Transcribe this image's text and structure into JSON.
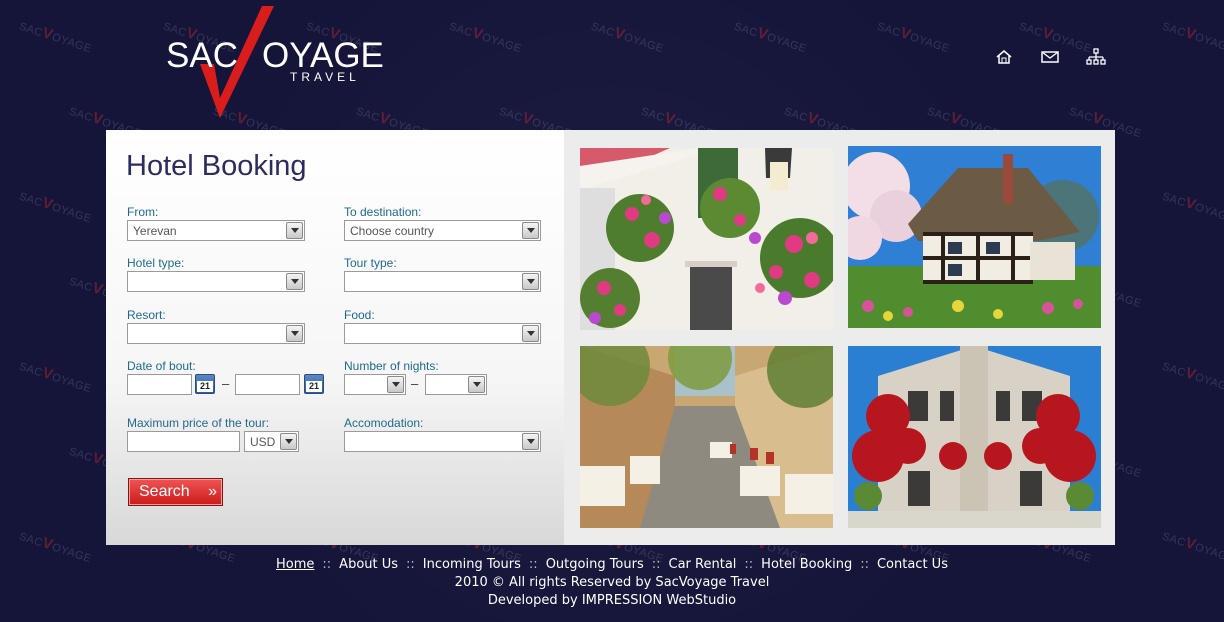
{
  "header": {
    "logo_left": "SAC",
    "logo_right": "OYAGE",
    "logo_sub": "TRAVEL",
    "watermark_text": "SACVOYAGE",
    "icons": [
      "home-icon",
      "mail-icon",
      "sitemap-icon"
    ]
  },
  "form": {
    "title": "Hotel Booking",
    "from": {
      "label": "From:",
      "value": "Yerevan"
    },
    "to_destination": {
      "label": "To destination:",
      "value": "Choose country"
    },
    "hotel_type": {
      "label": "Hotel type:",
      "value": ""
    },
    "tour_type": {
      "label": "Tour type:",
      "value": ""
    },
    "resort": {
      "label": "Resort:",
      "value": ""
    },
    "food": {
      "label": "Food:",
      "value": ""
    },
    "date_of_bout": {
      "label": "Date of bout:",
      "from": "",
      "to": "",
      "calendar_day": "21",
      "separator": "–"
    },
    "number_of_nights": {
      "label": "Number of nights:",
      "min": "",
      "max": "",
      "separator": "–"
    },
    "max_price": {
      "label": "Maximum price of the tour:",
      "value": "",
      "currency": "USD"
    },
    "accomodation": {
      "label": "Accomodation:",
      "value": ""
    },
    "search_label": "Search",
    "search_chevrons": "»"
  },
  "photos": [
    "flower-balcony-photo",
    "thatched-cottage-photo",
    "cafe-street-photo",
    "red-flower-house-photo"
  ],
  "footer": {
    "links": [
      "Home",
      "About Us",
      "Incoming Tours",
      "Outgoing Tours",
      "Car Rental",
      "Hotel Booking",
      "Contact Us"
    ],
    "separator": "::",
    "copyright": "2010 © All rights Reserved by SacVoyage Travel",
    "developer": "Developed by IMPRESSION WebStudio"
  },
  "colors": {
    "background": "#15153a",
    "accent_red": "#d42020",
    "label_blue": "#1f6a8c",
    "title": "#2c2c5e"
  }
}
